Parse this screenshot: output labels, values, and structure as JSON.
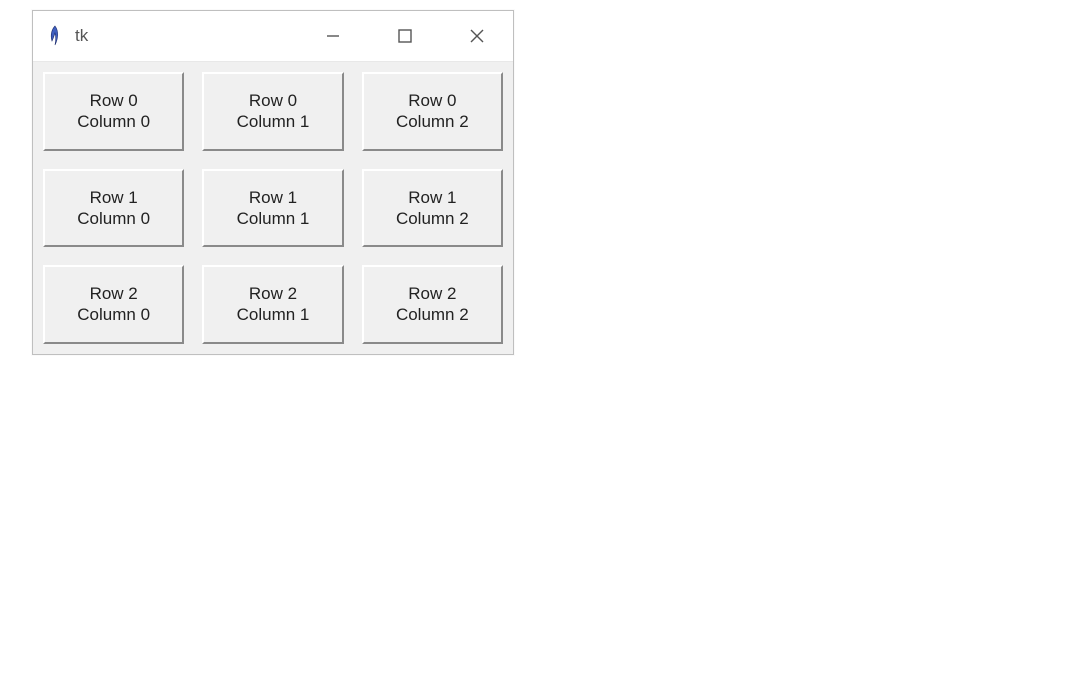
{
  "window": {
    "title": "tk"
  },
  "grid": {
    "rows": 3,
    "cols": 3,
    "cells": [
      [
        {
          "label": "Row 0\nColumn 0"
        },
        {
          "label": "Row 0\nColumn 1"
        },
        {
          "label": "Row 0\nColumn 2"
        }
      ],
      [
        {
          "label": "Row 1\nColumn 0"
        },
        {
          "label": "Row 1\nColumn 1"
        },
        {
          "label": "Row 1\nColumn 2"
        }
      ],
      [
        {
          "label": "Row 2\nColumn 0"
        },
        {
          "label": "Row 2\nColumn 1"
        },
        {
          "label": "Row 2\nColumn 2"
        }
      ]
    ]
  }
}
